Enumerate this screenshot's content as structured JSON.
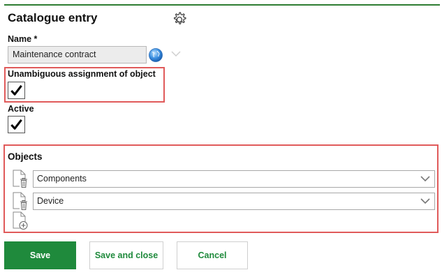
{
  "header": {
    "title": "Catalogue entry",
    "settings_icon": "gear-icon"
  },
  "name_field": {
    "label": "Name *",
    "value": "Maintenance contract"
  },
  "unambiguous": {
    "label": "Unambiguous assignment of object",
    "checked": true
  },
  "active": {
    "label": "Active",
    "checked": true
  },
  "objects": {
    "title": "Objects",
    "rows": [
      {
        "value": "Components",
        "icon": "delete-document-icon"
      },
      {
        "value": "Device",
        "icon": "delete-document-icon"
      }
    ],
    "add_icon": "add-document-icon"
  },
  "buttons": {
    "save": "Save",
    "save_close": "Save and close",
    "cancel": "Cancel"
  },
  "colors": {
    "accent": "#1f8a3c",
    "highlight_border": "#e05a5a"
  }
}
